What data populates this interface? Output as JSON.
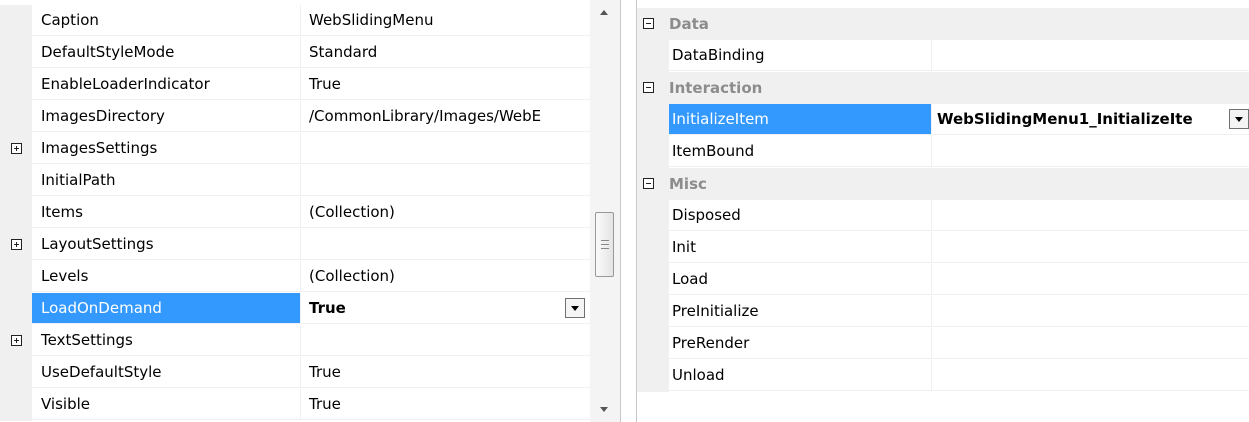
{
  "left_grid": {
    "rows": [
      {
        "name": "Caption",
        "value": "WebSlidingMenu"
      },
      {
        "name": "DefaultStyleMode",
        "value": "Standard"
      },
      {
        "name": "EnableLoaderIndicator",
        "value": "True"
      },
      {
        "name": "ImagesDirectory",
        "value": "/CommonLibrary/Images/WebE"
      },
      {
        "name": "ImagesSettings",
        "value": ""
      },
      {
        "name": "InitialPath",
        "value": ""
      },
      {
        "name": "Items",
        "value": "(Collection)"
      },
      {
        "name": "LayoutSettings",
        "value": ""
      },
      {
        "name": "Levels",
        "value": "(Collection)"
      },
      {
        "name": "LoadOnDemand",
        "value": "True"
      },
      {
        "name": "TextSettings",
        "value": ""
      },
      {
        "name": "UseDefaultStyle",
        "value": "True"
      },
      {
        "name": "Visible",
        "value": "True"
      }
    ]
  },
  "right_grid": {
    "categories": {
      "data": "Data",
      "interaction": "Interaction",
      "misc": "Misc"
    },
    "rows": {
      "databinding": {
        "name": "DataBinding",
        "value": ""
      },
      "initializeitem": {
        "name": "InitializeItem",
        "value": "WebSlidingMenu1_InitializeIte"
      },
      "itembound": {
        "name": "ItemBound",
        "value": ""
      },
      "disposed": {
        "name": "Disposed",
        "value": ""
      },
      "init": {
        "name": "Init",
        "value": ""
      },
      "load": {
        "name": "Load",
        "value": ""
      },
      "preinitialize": {
        "name": "PreInitialize",
        "value": ""
      },
      "prerender": {
        "name": "PreRender",
        "value": ""
      },
      "unload": {
        "name": "Unload",
        "value": ""
      }
    }
  },
  "colors": {
    "selection": "#3399ff",
    "category_bg": "#f0f0f0",
    "category_text": "#8c8c8c"
  }
}
